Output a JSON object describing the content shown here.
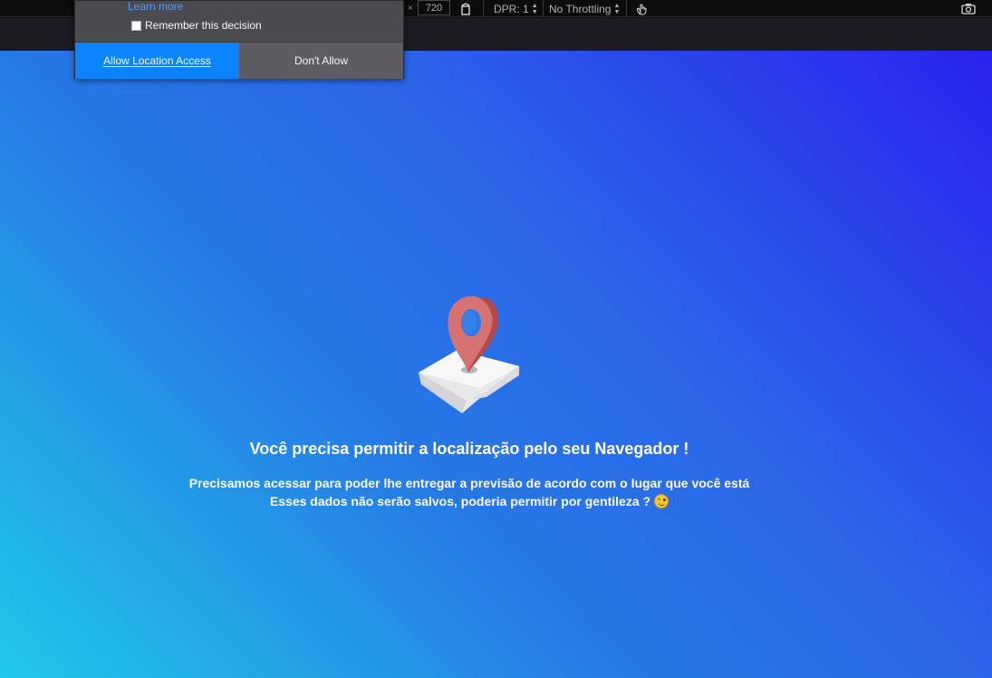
{
  "toolbar": {
    "dimension_separator": "×",
    "height_value": "720",
    "dpr_label": "DPR: 1",
    "throttling_label": "No Throttling",
    "rotate_icon": "rotate-device-icon",
    "touch_icon": "touch-simulation-icon",
    "screenshot_icon": "camera-icon"
  },
  "permission_prompt": {
    "learn_more": "Learn more",
    "remember_label": "Remember this decision",
    "remember_checked": false,
    "allow_button": "Allow Location Access",
    "deny_button": "Don't Allow",
    "colors": {
      "allow": "#0a84ff",
      "panel": "#4a4a4f"
    }
  },
  "page": {
    "icon": "location-pin-map-icon",
    "headline": "Você precisa permitir a localização pelo seu Navegador !",
    "line1": "Precisamos acessar para poder lhe entregar a previsão de acordo com o lugar que você está",
    "line2": "Esses dados não serão salvos, poderia permitir por gentileza ?",
    "emoji": "winking-face-icon",
    "gradient": [
      "#1fc8e8",
      "#2677e6",
      "#2a22ee"
    ]
  }
}
